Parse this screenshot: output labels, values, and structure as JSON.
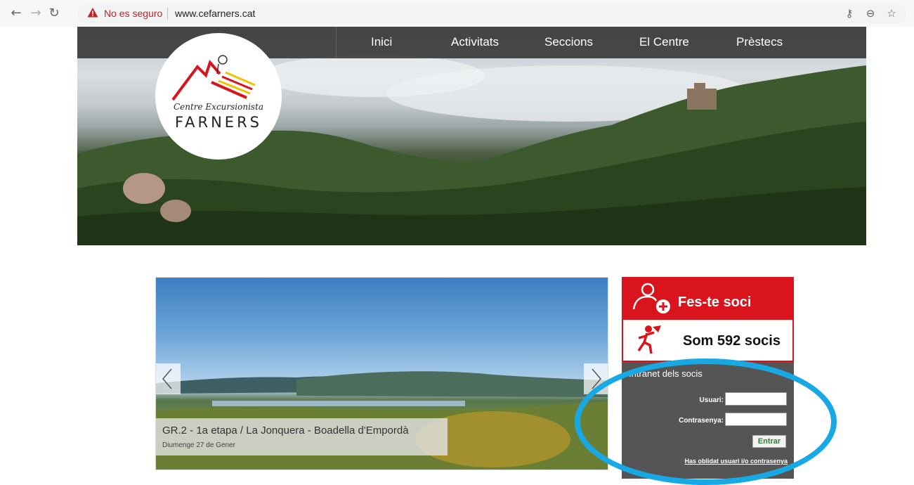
{
  "browser": {
    "security_label": "No es seguro",
    "url": "www.cefarners.cat",
    "icons": [
      "back-arrow-icon",
      "forward-arrow-icon",
      "reload-icon",
      "warning-icon",
      "key-icon",
      "zoom-icon",
      "star-icon"
    ]
  },
  "nav": {
    "items": [
      "Inici",
      "Activitats",
      "Seccions",
      "El Centre",
      "Prèstecs"
    ]
  },
  "logo": {
    "subtitle": "Centre Excursionista",
    "name": "FARNERS"
  },
  "slider": {
    "title": "GR.2 - 1a etapa / La Jonquera - Boadella d'Empordà",
    "date": "Diumenge 27 de Gener"
  },
  "sidebar": {
    "join_label": "Fes-te soci",
    "members_label": "Som 592 socis",
    "intranet": {
      "title": "Intranet dels socis",
      "user_label": "Usuari:",
      "password_label": "Contrasenya:",
      "user_value": "",
      "password_value": "",
      "submit_label": "Entrar",
      "forgot_link": "Has oblidat usuari i/o contrasenya"
    }
  },
  "colors": {
    "brand_red": "#d9141c",
    "annotation_blue": "#17a9e6",
    "nav_bar": "#282828",
    "intranet_panel": "#555555"
  }
}
